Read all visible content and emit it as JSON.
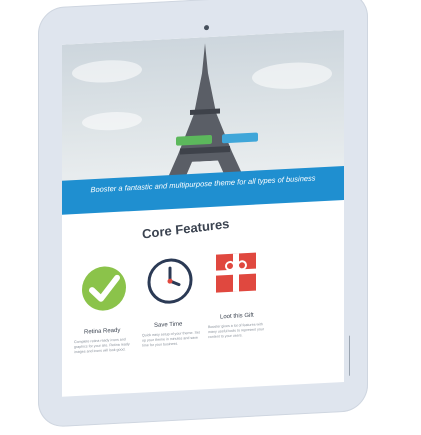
{
  "hero": {
    "tagline": "Booster a fantastic and multipurpose theme for all types of business",
    "primary_button": "",
    "secondary_button": ""
  },
  "section": {
    "title": "Core Features"
  },
  "features": [
    {
      "title": "Retina Ready",
      "icon": "checkmark-icon",
      "color": "#8bc34a",
      "text": "Complete retina ready icons and graphics for your site. Retina ready images and icons will look good."
    },
    {
      "title": "Save Time",
      "icon": "clock-icon",
      "color": "#2b3a55",
      "text": "Quick easy setup of your theme. Set up your theme in minutes and save time for your business."
    },
    {
      "title": "Loot this Gift",
      "icon": "gift-icon",
      "color": "#e0483f",
      "text": "Booster gives a lot of features with many useful tools to represent your content to your users."
    }
  ],
  "colors": {
    "accent": "#1f8fd0",
    "device": "#dfe5ee"
  }
}
